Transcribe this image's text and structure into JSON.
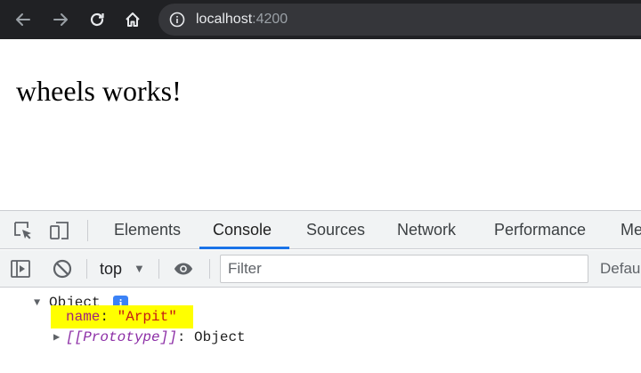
{
  "browser": {
    "url_host": "localhost",
    "url_port": ":4200",
    "icons": {
      "back": "back-arrow-icon",
      "forward": "forward-arrow-icon",
      "reload": "reload-icon",
      "home": "home-icon",
      "site_info": "info-circle-icon"
    },
    "colors": {
      "toolbar": "#202124",
      "omnibox": "#35363a"
    }
  },
  "page": {
    "heading": "wheels works!"
  },
  "devtools": {
    "tabs": [
      {
        "label": "Elements",
        "active": false
      },
      {
        "label": "Console",
        "active": true
      },
      {
        "label": "Sources",
        "active": false
      },
      {
        "label": "Network",
        "active": false
      },
      {
        "label": "Performance",
        "active": false
      },
      {
        "label": "Me",
        "active": false
      }
    ],
    "toolbar_icons": [
      "inspect-element-icon",
      "device-toggle-icon"
    ],
    "console_toolbar": {
      "context": "top",
      "filter_placeholder": "Filter",
      "levels": "Defau"
    },
    "console": {
      "object_label": "Object",
      "info_badge": "i",
      "property_key": "name",
      "property_sep": ": ",
      "property_value": "\"Arpit\"",
      "proto_key": "[[Prototype]]",
      "proto_sep": ": ",
      "proto_value": "Object"
    },
    "colors": {
      "accent": "#1a73e8",
      "highlight": "#ffff00",
      "string": "#c41a16",
      "key": "#a0237a"
    }
  }
}
